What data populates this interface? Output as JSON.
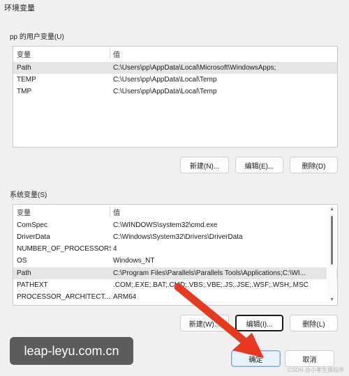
{
  "window": {
    "title": "环境变量"
  },
  "user_vars": {
    "label": "pp 的用户变量(U)",
    "columns": {
      "name": "变量",
      "value": "值"
    },
    "rows": [
      {
        "name": "Path",
        "value": "C:\\Users\\pp\\AppData\\Local\\Microsoft\\WindowsApps;"
      },
      {
        "name": "TEMP",
        "value": "C:\\Users\\pp\\AppData\\Local\\Temp"
      },
      {
        "name": "TMP",
        "value": "C:\\Users\\pp\\AppData\\Local\\Temp"
      }
    ],
    "buttons": {
      "new": "新建(N)...",
      "edit": "编辑(E)...",
      "delete": "删除(D)"
    }
  },
  "system_vars": {
    "label": "系统变量(S)",
    "columns": {
      "name": "变量",
      "value": "值"
    },
    "rows": [
      {
        "name": "ComSpec",
        "value": "C:\\WINDOWS\\system32\\cmd.exe"
      },
      {
        "name": "DriverData",
        "value": "C:\\Windows\\System32\\Drivers\\DriverData"
      },
      {
        "name": "NUMBER_OF_PROCESSORS",
        "value": "4"
      },
      {
        "name": "OS",
        "value": "Windows_NT"
      },
      {
        "name": "Path",
        "value": "C:\\Program Files\\Parallels\\Parallels Tools\\Applications;C:\\WI..."
      },
      {
        "name": "PATHEXT",
        "value": ".COM;.EXE;.BAT;.CMD;.VBS;.VBE;.JS;.JSE;.WSF;.WSH;.MSC"
      },
      {
        "name": "PROCESSOR_ARCHITECT...",
        "value": "ARM64"
      }
    ],
    "buttons": {
      "new": "新建(W)...",
      "edit": "编辑(I)...",
      "delete": "删除(L)"
    }
  },
  "footer": {
    "ok": "确定",
    "cancel": "取消"
  },
  "watermark": {
    "text": "leap-leyu.com.cn"
  },
  "csdn_mark": "CSDN @小孝生搞程序",
  "colors": {
    "selected_row": "#e5e5e5",
    "arrow": "#e53a1f"
  }
}
